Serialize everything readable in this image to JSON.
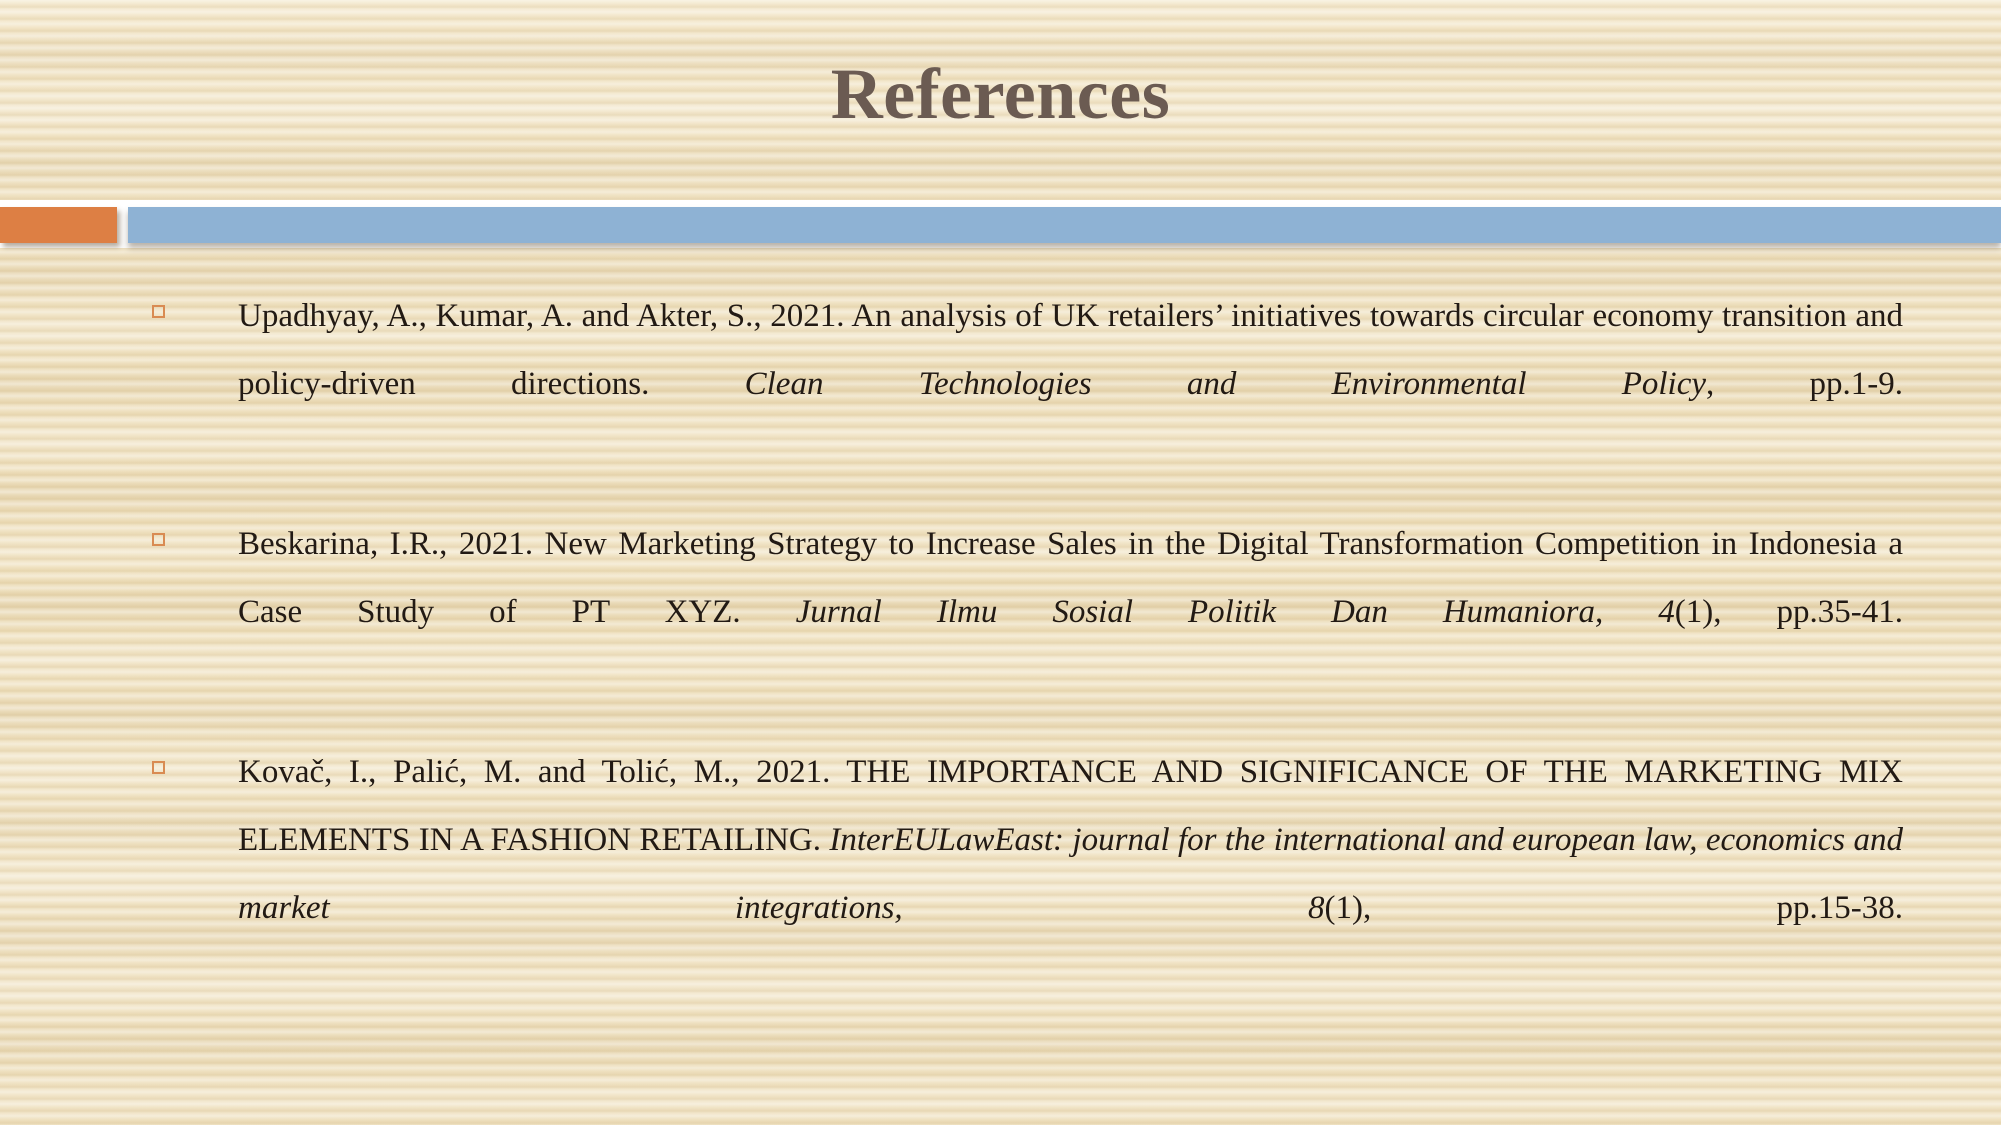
{
  "slide": {
    "title": "References",
    "background_color": "#EFE0BE",
    "title_color": "#6B5B52",
    "accent_orange": "#DD7F44",
    "accent_blue": "#8EB2D4",
    "bullet_color": "#D98B52",
    "body_text_color": "#221A14"
  },
  "references": [
    {
      "bullet": "square-outline-bullet",
      "segments": [
        {
          "style": "regular",
          "text": "Upadhyay, A., Kumar, A. and Akter, S., 2021. An analysis of UK retailers’ initiatives towards circular economy transition and policy-driven directions. "
        },
        {
          "style": "italic",
          "text": "Clean Technologies and Environmental Policy"
        },
        {
          "style": "regular",
          "text": ", pp.1-9."
        }
      ],
      "plain": "Upadhyay, A., Kumar, A. and Akter, S., 2021. An analysis of UK retailers’ initiatives towards circular economy transition and policy-driven directions. Clean Technologies and Environmental Policy, pp.1-9."
    },
    {
      "bullet": "square-outline-bullet",
      "segments": [
        {
          "style": "regular",
          "text": "Beskarina, I.R., 2021. New Marketing Strategy to Increase Sales in the Digital Transformation Competition in Indonesia a Case Study of PT XYZ. "
        },
        {
          "style": "italic",
          "text": "Jurnal Ilmu Sosial Politik Dan Humaniora, 4"
        },
        {
          "style": "regular",
          "text": "(1), pp.35-41."
        }
      ],
      "plain": "Beskarina, I.R., 2021. New Marketing Strategy to Increase Sales in the Digital Transformation Competition in Indonesia a Case Study of PT XYZ. Jurnal Ilmu Sosial Politik Dan Humaniora, 4(1), pp.35-41."
    },
    {
      "bullet": "square-outline-bullet",
      "segments": [
        {
          "style": "regular",
          "text": "Kovač, I., Palić, M. and Tolić, M., 2021. THE IMPORTANCE AND SIGNIFICANCE OF THE MARKETING MIX ELEMENTS IN A FASHION RETAILING. "
        },
        {
          "style": "italic",
          "text": "InterEULawEast: journal for the international and european law, economics and market integrations, 8"
        },
        {
          "style": "regular",
          "text": "(1), pp.15-38."
        }
      ],
      "plain": "Kovač, I., Palić, M. and Tolić, M., 2021. THE IMPORTANCE AND SIGNIFICANCE OF THE MARKETING MIX ELEMENTS IN A FASHION RETAILING. InterEULawEast: journal for the international and european law, economics and market integrations, 8(1), pp.15-38."
    }
  ]
}
